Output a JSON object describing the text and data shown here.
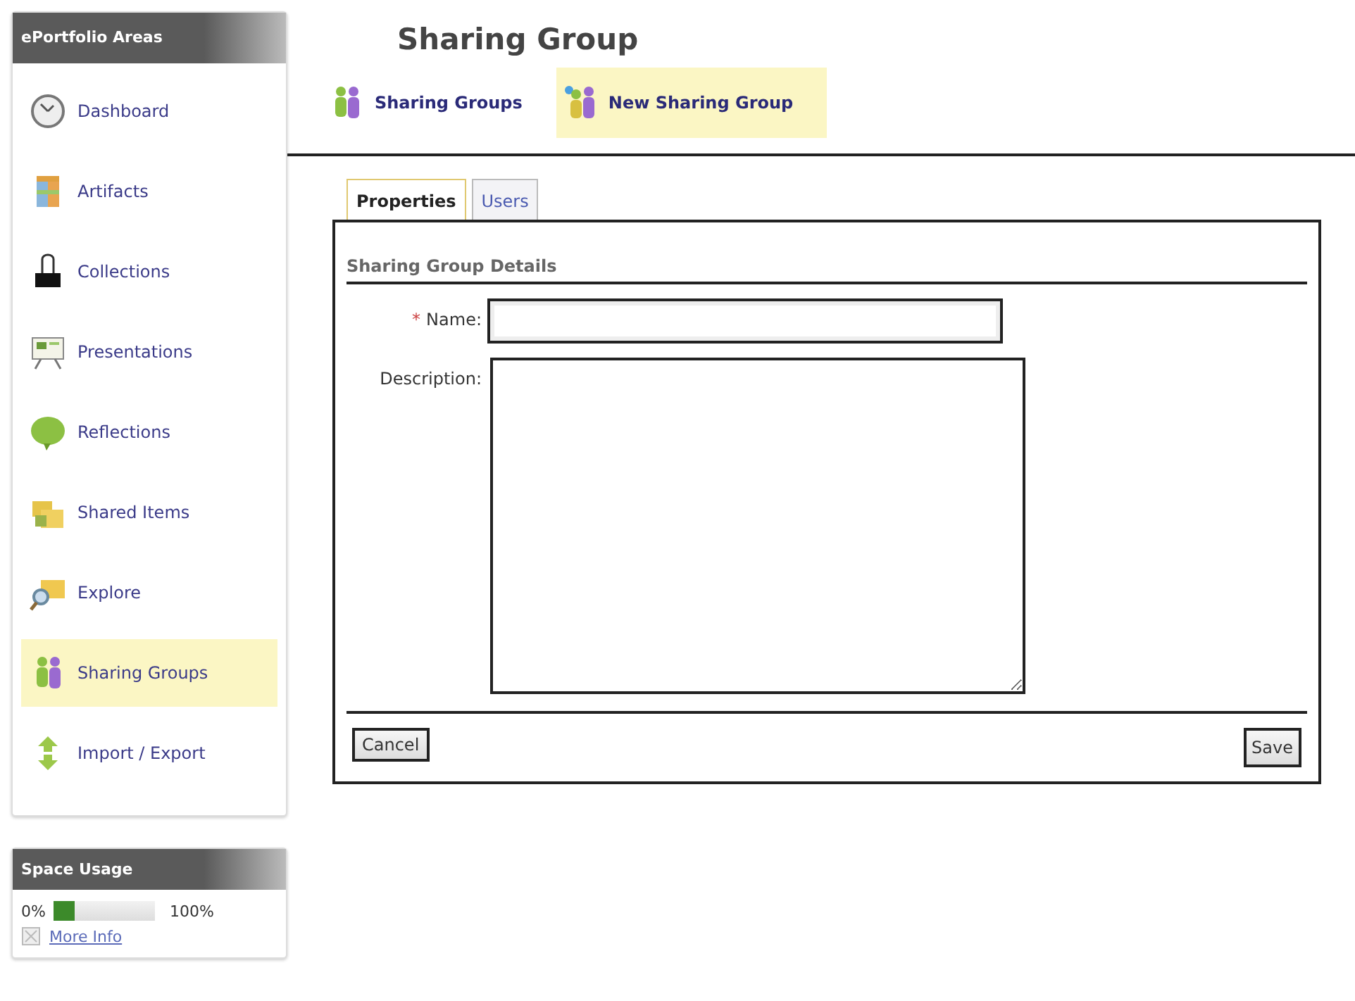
{
  "sidebar": {
    "title": "ePortfolio Areas",
    "items": [
      {
        "label": "Dashboard",
        "selected": false
      },
      {
        "label": "Artifacts",
        "selected": false
      },
      {
        "label": "Collections",
        "selected": false
      },
      {
        "label": "Presentations",
        "selected": false
      },
      {
        "label": "Reflections",
        "selected": false
      },
      {
        "label": "Shared Items",
        "selected": false
      },
      {
        "label": "Explore",
        "selected": false
      },
      {
        "label": "Sharing Groups",
        "selected": true
      },
      {
        "label": "Import / Export",
        "selected": false
      }
    ]
  },
  "space_usage": {
    "title": "Space Usage",
    "min_label": "0%",
    "max_label": "100%",
    "level": 0.2,
    "link": "More Info"
  },
  "page": {
    "title": "Sharing Group",
    "links": [
      {
        "label": "Sharing Groups",
        "selected": false
      },
      {
        "label": "New Sharing Group",
        "selected": true
      }
    ]
  },
  "tabs": [
    {
      "label": "Properties",
      "selected": true
    },
    {
      "label": "Users",
      "selected": false
    }
  ],
  "form": {
    "section": "Sharing Group Details",
    "fields": [
      {
        "label": "Name:",
        "kind": "input",
        "required_mark": "*"
      },
      {
        "label": "Description:",
        "kind": "textarea"
      }
    ],
    "buttons": [
      {
        "label": "Cancel",
        "kind": "cancel"
      },
      {
        "label": "Save",
        "kind": "save"
      }
    ]
  }
}
